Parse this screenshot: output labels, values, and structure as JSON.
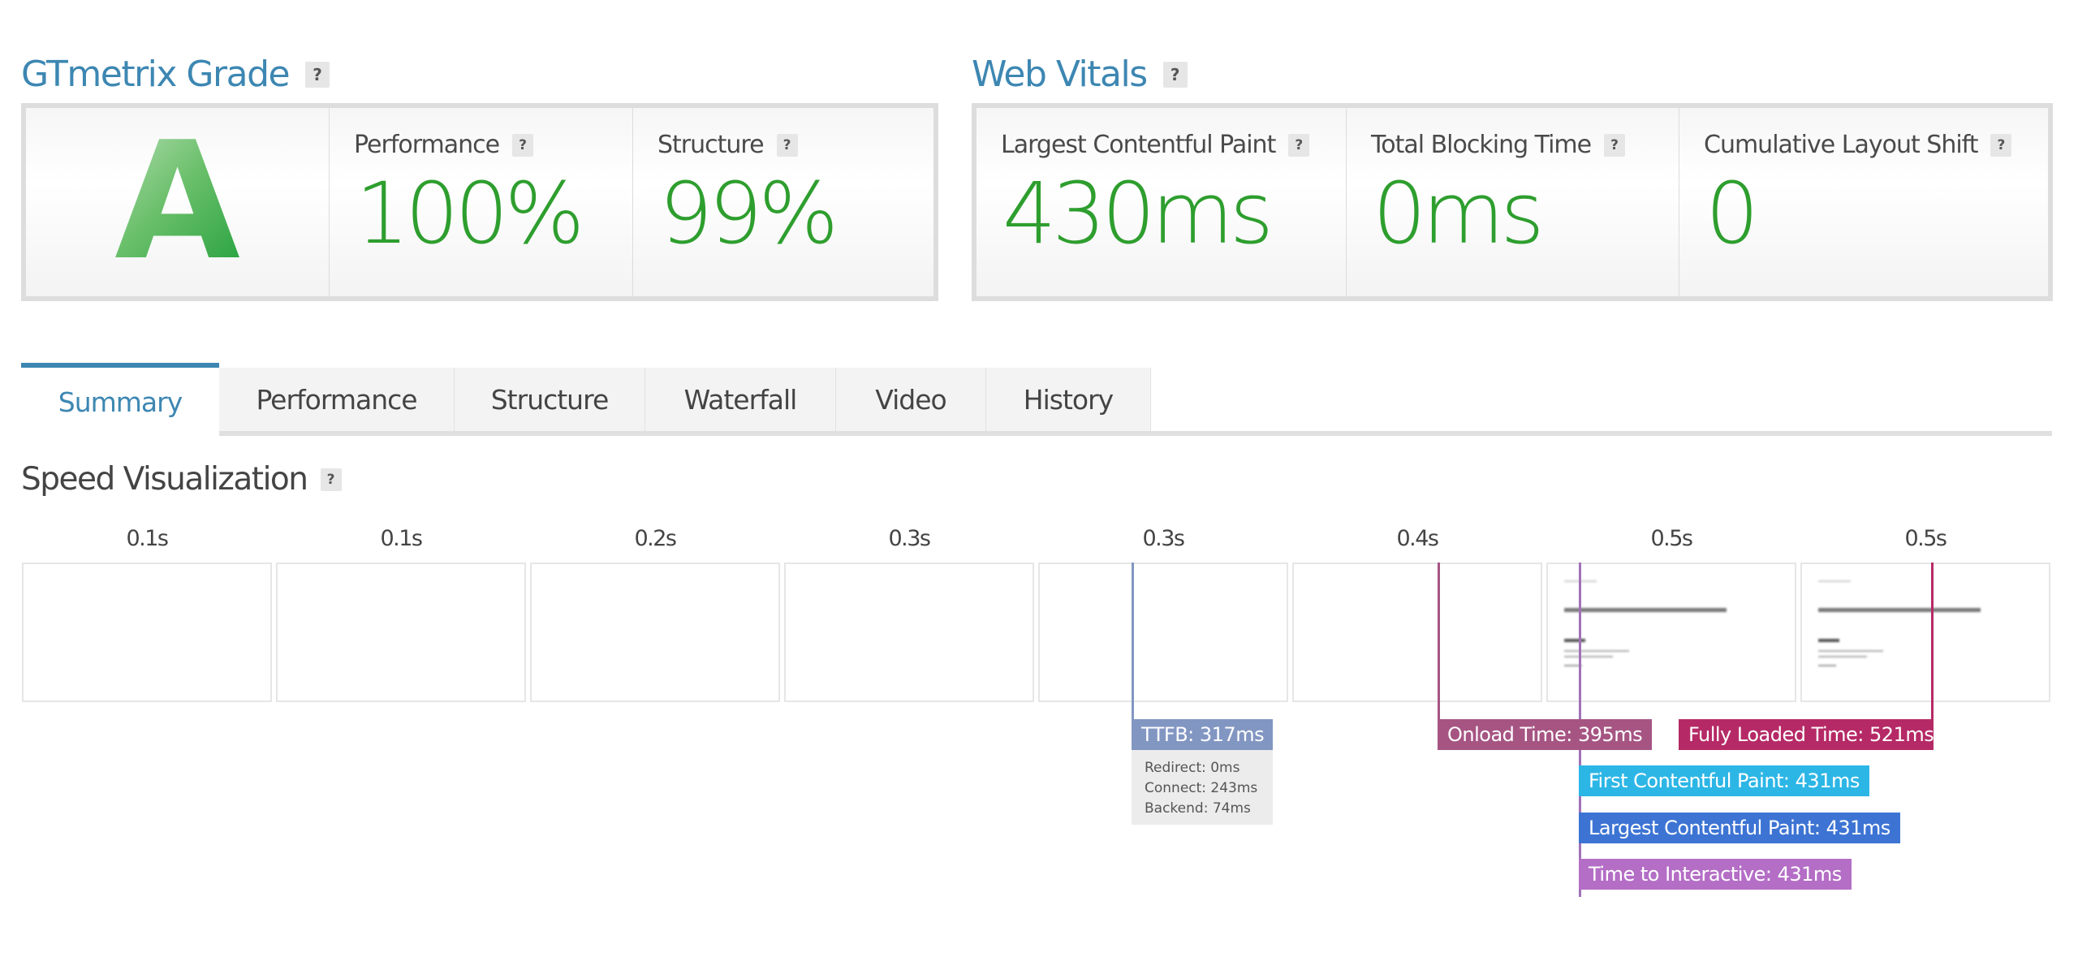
{
  "grade_section": {
    "title": "GTmetrix Grade",
    "help": "?",
    "grade": "A",
    "metrics": [
      {
        "label": "Performance",
        "value": "100%"
      },
      {
        "label": "Structure",
        "value": "99%"
      }
    ]
  },
  "vitals_section": {
    "title": "Web Vitals",
    "help": "?",
    "metrics": [
      {
        "label": "Largest Contentful Paint",
        "value": "430ms"
      },
      {
        "label": "Total Blocking Time",
        "value": "0ms"
      },
      {
        "label": "Cumulative Layout Shift",
        "value": "0"
      }
    ]
  },
  "tabs": [
    {
      "label": "Summary",
      "active": true
    },
    {
      "label": "Performance",
      "active": false
    },
    {
      "label": "Structure",
      "active": false
    },
    {
      "label": "Waterfall",
      "active": false
    },
    {
      "label": "Video",
      "active": false
    },
    {
      "label": "History",
      "active": false
    }
  ],
  "speed_visualization": {
    "title": "Speed Visualization",
    "help": "?",
    "frames": [
      {
        "time": "0.1s",
        "rendered": false
      },
      {
        "time": "0.1s",
        "rendered": false
      },
      {
        "time": "0.2s",
        "rendered": false
      },
      {
        "time": "0.3s",
        "rendered": false
      },
      {
        "time": "0.3s",
        "rendered": false
      },
      {
        "time": "0.4s",
        "rendered": false
      },
      {
        "time": "0.5s",
        "rendered": true
      },
      {
        "time": "0.5s",
        "rendered": true
      }
    ],
    "markers": {
      "ttfb": {
        "label": "TTFB: 317ms",
        "color": "#8296c2"
      },
      "onload": {
        "label": "Onload Time: 395ms",
        "color": "#a65583"
      },
      "fully_loaded": {
        "label": "Fully Loaded Time: 521ms",
        "color": "#b52a66"
      },
      "fcp": {
        "label": "First Contentful Paint: 431ms",
        "color": "#2cb6e6"
      },
      "lcp": {
        "label": "Largest Contentful Paint: 431ms",
        "color": "#3d74d4"
      },
      "tti": {
        "label": "Time to Interactive: 431ms",
        "color": "#b46ec6"
      }
    },
    "ttfb_details": [
      "Redirect: 0ms",
      "Connect: 243ms",
      "Backend: 74ms"
    ]
  },
  "colors": {
    "accent": "#3d87b2",
    "good": "#2e9e2e"
  }
}
